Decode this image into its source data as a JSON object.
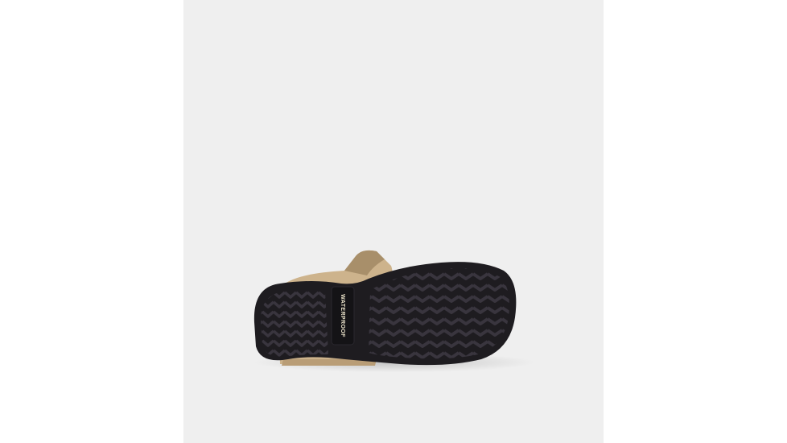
{
  "image": {
    "subject": "boot-outsole",
    "colors": {
      "canvas": "#ffffff",
      "panel": "#efefef",
      "outsole": "#1e1c20",
      "tread": "#2e2b31",
      "upper": "#cdb38c",
      "upper_shadow": "#a88f6a",
      "badge": "#141316"
    },
    "badge": {
      "text": "WATERPROOF"
    }
  }
}
